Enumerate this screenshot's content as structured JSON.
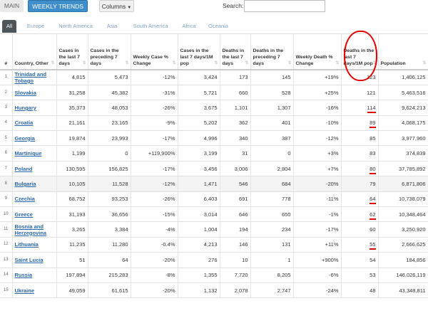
{
  "toolbar": {
    "main_label": "MAIN",
    "weekly_label": "WEEKLY TRENDS",
    "columns_label": "Columns",
    "search_label": "Search:",
    "search_value": ""
  },
  "tabs": [
    "All",
    "Europe",
    "North America",
    "Asia",
    "South America",
    "Africa",
    "Oceania"
  ],
  "active_tab": "All",
  "columns": [
    "#",
    "Country, Other",
    "Cases in the last 7 days",
    "Cases in the preceding 7 days",
    "Weekly Case % Change",
    "Cases in the last 7 days/1M pop",
    "Deaths in the last 7 days",
    "Deaths in the preceding 7 days",
    "Weekly Death % Change",
    "Deaths in the last 7 days/1M pop",
    "Population"
  ],
  "rows": [
    {
      "n": "1",
      "country": "Trinidad and Tobago",
      "c7": "4,815",
      "cp": "5,473",
      "wcc": "-12%",
      "c1m": "3,424",
      "d7": "173",
      "dp": "145",
      "wdc": "+19%",
      "d1m": "123",
      "pop": "1,406,125",
      "mark": false
    },
    {
      "n": "2",
      "country": "Slovakia",
      "c7": "31,258",
      "cp": "45,382",
      "wcc": "-31%",
      "c1m": "5,721",
      "d7": "660",
      "dp": "528",
      "wdc": "+25%",
      "d1m": "121",
      "pop": "5,463,516",
      "mark": false
    },
    {
      "n": "3",
      "country": "Hungary",
      "c7": "35,373",
      "cp": "48,053",
      "wcc": "-26%",
      "c1m": "3,675",
      "d7": "1,101",
      "dp": "1,307",
      "wdc": "-16%",
      "d1m": "114",
      "pop": "9,624,213",
      "mark": true
    },
    {
      "n": "4",
      "country": "Croatia",
      "c7": "21,161",
      "cp": "23,165",
      "wcc": "-9%",
      "c1m": "5,202",
      "d7": "362",
      "dp": "401",
      "wdc": "-10%",
      "d1m": "89",
      "pop": "4,068,175",
      "mark": true
    },
    {
      "n": "5",
      "country": "Georgia",
      "c7": "19,874",
      "cp": "23,993",
      "wcc": "-17%",
      "c1m": "4,996",
      "d7": "340",
      "dp": "387",
      "wdc": "-12%",
      "d1m": "85",
      "pop": "3,977,960",
      "mark": false
    },
    {
      "n": "6",
      "country": "Martinique",
      "c7": "1,199",
      "cp": "0",
      "wcc": "+119,900%",
      "c1m": "3,199",
      "d7": "31",
      "dp": "0",
      "wdc": "+3%",
      "d1m": "83",
      "pop": "374,839",
      "mark": false
    },
    {
      "n": "7",
      "country": "Poland",
      "c7": "130,595",
      "cp": "156,825",
      "wcc": "-17%",
      "c1m": "3,456",
      "d7": "3,006",
      "dp": "2,804",
      "wdc": "+7%",
      "d1m": "80",
      "pop": "37,785,892",
      "mark": true
    },
    {
      "n": "8",
      "country": "Bulgaria",
      "c7": "10,105",
      "cp": "11,528",
      "wcc": "-12%",
      "c1m": "1,471",
      "d7": "546",
      "dp": "684",
      "wdc": "-20%",
      "d1m": "79",
      "pop": "6,871,806",
      "mark": false
    },
    {
      "n": "9",
      "country": "Czechia",
      "c7": "68,752",
      "cp": "93,253",
      "wcc": "-26%",
      "c1m": "6,403",
      "d7": "691",
      "dp": "778",
      "wdc": "-11%",
      "d1m": "64",
      "pop": "10,738,079",
      "mark": true
    },
    {
      "n": "10",
      "country": "Greece",
      "c7": "31,193",
      "cp": "36,656",
      "wcc": "-15%",
      "c1m": "3,014",
      "d7": "646",
      "dp": "650",
      "wdc": "-1%",
      "d1m": "62",
      "pop": "10,348,464",
      "mark": true
    },
    {
      "n": "11",
      "country": "Bosnia and Herzegovina",
      "c7": "3,265",
      "cp": "3,384",
      "wcc": "-4%",
      "c1m": "1,004",
      "d7": "194",
      "dp": "234",
      "wdc": "-17%",
      "d1m": "60",
      "pop": "3,250,920",
      "mark": false
    },
    {
      "n": "12",
      "country": "Lithuania",
      "c7": "11,235",
      "cp": "11,280",
      "wcc": "-0.4%",
      "c1m": "4,213",
      "d7": "146",
      "dp": "131",
      "wdc": "+11%",
      "d1m": "55",
      "pop": "2,666,625",
      "mark": true
    },
    {
      "n": "13",
      "country": "Saint Lucia",
      "c7": "51",
      "cp": "64",
      "wcc": "-20%",
      "c1m": "276",
      "d7": "10",
      "dp": "1",
      "wdc": "+900%",
      "d1m": "54",
      "pop": "184,856",
      "mark": false
    },
    {
      "n": "14",
      "country": "Russia",
      "c7": "197,894",
      "cp": "215,283",
      "wcc": "-8%",
      "c1m": "1,355",
      "d7": "7,720",
      "dp": "8,205",
      "wdc": "-6%",
      "d1m": "53",
      "pop": "146,026,119",
      "mark": false
    },
    {
      "n": "15",
      "country": "Ukraine",
      "c7": "49,059",
      "cp": "61,615",
      "wcc": "-20%",
      "c1m": "1,132",
      "d7": "2,078",
      "dp": "2,747",
      "wdc": "-24%",
      "d1m": "48",
      "pop": "43,348,811",
      "mark": false
    }
  ],
  "colors": {
    "accent": "#3d8ec9",
    "link": "#2b67a8",
    "annotation": "#e30000",
    "tab_active": "#4e555b"
  }
}
